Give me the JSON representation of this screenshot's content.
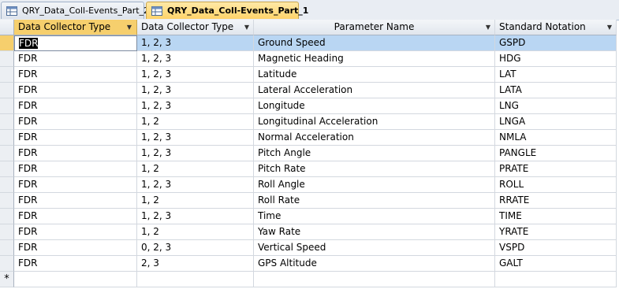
{
  "tabs": [
    {
      "label": "QRY_Data_Coll-Events_Part_2",
      "active": false
    },
    {
      "label": "QRY_Data_Coll-Events_Part_1",
      "active": true
    }
  ],
  "columns": [
    "Data Collector Type",
    "Data Collector Type",
    "Parameter Name",
    "Standard Notation"
  ],
  "rows": [
    [
      "FDR",
      "1, 2, 3",
      "Ground Speed",
      "GSPD"
    ],
    [
      "FDR",
      "1, 2, 3",
      "Magnetic Heading",
      "HDG"
    ],
    [
      "FDR",
      "1, 2, 3",
      "Latitude",
      "LAT"
    ],
    [
      "FDR",
      "1, 2, 3",
      "Lateral Acceleration",
      "LATA"
    ],
    [
      "FDR",
      "1, 2, 3",
      "Longitude",
      "LNG"
    ],
    [
      "FDR",
      "1, 2",
      "Longitudinal Acceleration",
      "LNGA"
    ],
    [
      "FDR",
      "1, 2, 3",
      "Normal Acceleration",
      "NMLA"
    ],
    [
      "FDR",
      "1, 2, 3",
      "Pitch Angle",
      "PANGLE"
    ],
    [
      "FDR",
      "1, 2",
      "Pitch Rate",
      "PRATE"
    ],
    [
      "FDR",
      "1, 2, 3",
      "Roll Angle",
      "ROLL"
    ],
    [
      "FDR",
      "1, 2",
      "Roll Rate",
      "RRATE"
    ],
    [
      "FDR",
      "1, 2, 3",
      "Time",
      "TIME"
    ],
    [
      "FDR",
      "1, 2",
      "Yaw Rate",
      "YRATE"
    ],
    [
      "FDR",
      "0, 2, 3",
      "Vertical Speed",
      "VSPD"
    ],
    [
      "FDR",
      "2, 3",
      "GPS Altitude",
      "GALT"
    ]
  ],
  "new_row_marker": "*",
  "colors": {
    "active_header": "#f6cf6d",
    "selected_row": "#b9d6f3"
  }
}
